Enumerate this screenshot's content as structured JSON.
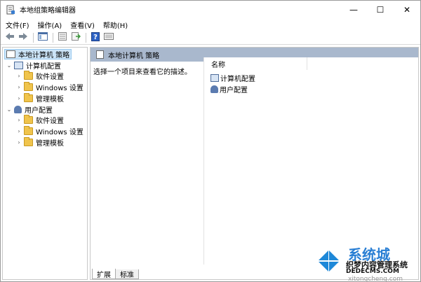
{
  "window": {
    "title": "本地组策略编辑器",
    "controls": {
      "minimize": "—",
      "maximize": "☐",
      "close": "✕"
    }
  },
  "menubar": [
    {
      "label": "文件(F)"
    },
    {
      "label": "操作(A)"
    },
    {
      "label": "查看(V)"
    },
    {
      "label": "帮助(H)"
    }
  ],
  "toolbar": {
    "icons": [
      "back-icon",
      "forward-icon",
      "console-tree-icon",
      "properties-icon",
      "export-list-icon",
      "help-icon",
      "filter-icon"
    ]
  },
  "tree": {
    "root": "本地计算机 策略",
    "computer_config": "计算机配置",
    "user_config": "用户配置",
    "computer_children": [
      "软件设置",
      "Windows 设置",
      "管理模板"
    ],
    "user_children": [
      "软件设置",
      "Windows 设置",
      "管理模板"
    ]
  },
  "right_pane": {
    "header": "本地计算机 策略",
    "description": "选择一个项目来查看它的描述。",
    "column_name": "名称",
    "items": [
      "计算机配置",
      "用户配置"
    ],
    "tabs": [
      "扩展",
      "标准"
    ]
  },
  "watermark": {
    "big_text": "系统城",
    "line1": "织梦内容管理系统",
    "line2": "DEDECMS.COM",
    "line3": "xitongcheng.com",
    "logo_color": "#1e88d8"
  }
}
